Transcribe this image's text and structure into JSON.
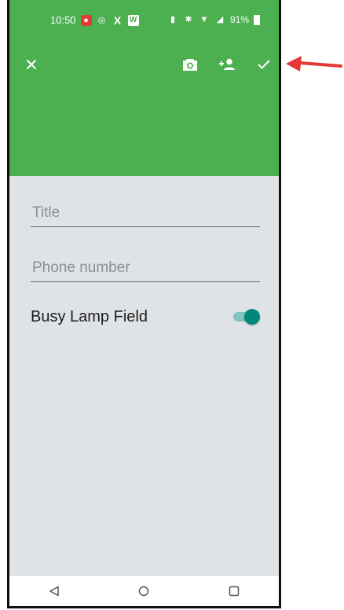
{
  "status_bar": {
    "time": "10:50",
    "battery": "91%"
  },
  "toolbar": {
    "close_icon": "close-icon",
    "camera_icon": "camera-icon",
    "add_person_icon": "add-person-icon",
    "save_icon": "check-icon",
    "color": "#4caf50"
  },
  "form": {
    "title_placeholder": "Title",
    "title_value": "",
    "phone_placeholder": "Phone number",
    "phone_value": "",
    "blf_label": "Busy Lamp Field",
    "blf_enabled": true,
    "toggle_color": "#00897b"
  },
  "annotation": {
    "arrow_color": "#e53935"
  }
}
